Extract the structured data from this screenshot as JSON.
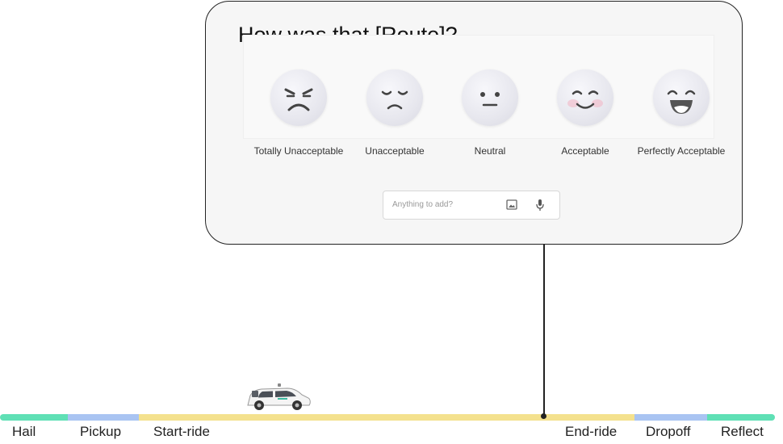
{
  "feedback_card": {
    "title": "How was that [Route]?",
    "options": [
      {
        "label": "Totally Unacceptable",
        "icon": "very-sad-face-icon"
      },
      {
        "label": "Unacceptable",
        "icon": "sad-face-icon"
      },
      {
        "label": "Neutral",
        "icon": "neutral-face-icon"
      },
      {
        "label": "Acceptable",
        "icon": "smile-face-icon"
      },
      {
        "label": "Perfectly Acceptable",
        "icon": "big-smile-face-icon"
      }
    ],
    "comment": {
      "placeholder": "Anything to add?",
      "icons": [
        "image-icon",
        "microphone-icon"
      ]
    }
  },
  "timeline": {
    "stages": [
      {
        "label": "Hail",
        "color": "#5fe0b5"
      },
      {
        "label": "Pickup",
        "color": "#a9c4f2"
      },
      {
        "label": "Start-ride",
        "color": "#f4e18e"
      },
      {
        "label": "End-ride",
        "color": "#f4e18e"
      },
      {
        "label": "Dropoff",
        "color": "#a9c4f2"
      },
      {
        "label": "Reflect",
        "color": "#5fe0b5"
      }
    ],
    "vehicle_icon": "self-driving-car-icon"
  }
}
